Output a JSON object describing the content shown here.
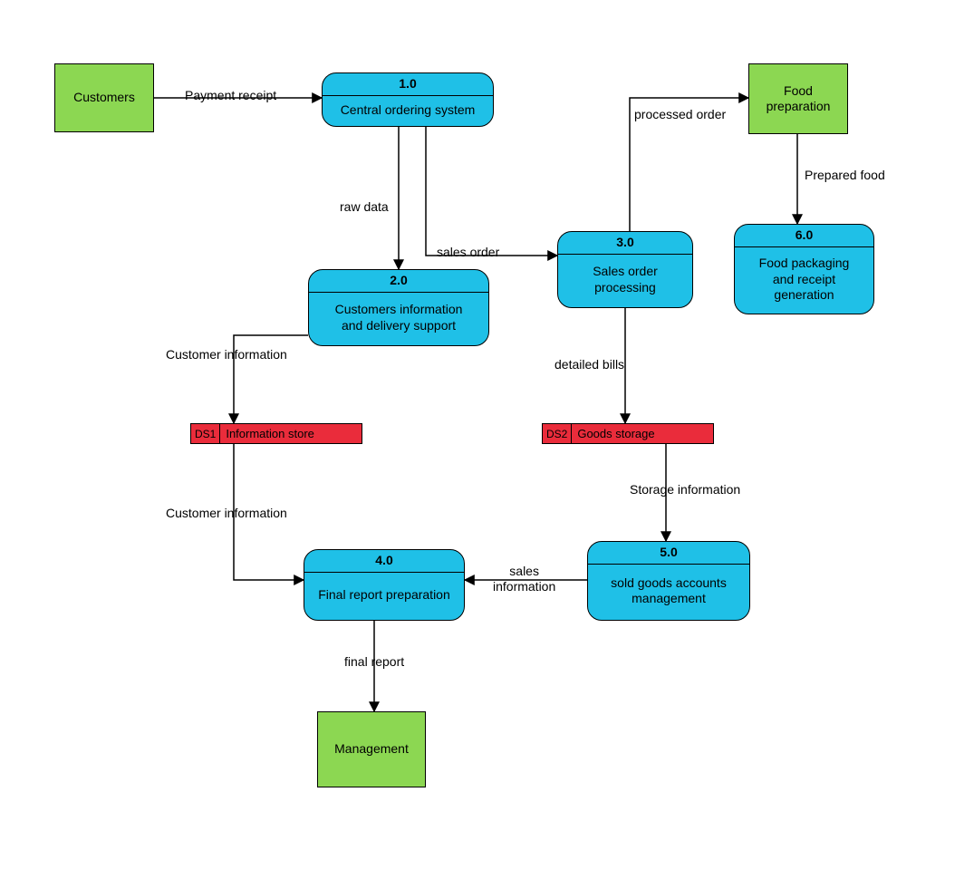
{
  "entities": {
    "customers": {
      "label": "Customers"
    },
    "food_prep": {
      "label": "Food\npreparation"
    },
    "management": {
      "label": "Management"
    }
  },
  "processes": {
    "p1": {
      "num": "1.0",
      "name": "Central ordering system"
    },
    "p2": {
      "num": "2.0",
      "name": "Customers information\nand delivery support"
    },
    "p3": {
      "num": "3.0",
      "name": "Sales order\nprocessing"
    },
    "p4": {
      "num": "4.0",
      "name": "Final report preparation"
    },
    "p5": {
      "num": "5.0",
      "name": "sold goods accounts\nmanagement"
    },
    "p6": {
      "num": "6.0",
      "name": "Food packaging\nand receipt\ngeneration"
    }
  },
  "datastores": {
    "ds1": {
      "id": "DS1",
      "name": "Information store"
    },
    "ds2": {
      "id": "DS2",
      "name": "Goods storage"
    }
  },
  "flows": {
    "f_payment_receipt": "Payment receipt",
    "f_raw_data": "raw data",
    "f_sales_order": "sales order",
    "f_customer_info_1": "Customer information",
    "f_customer_info_2": "Customer information",
    "f_processed_order": "processed order",
    "f_prepared_food": "Prepared food",
    "f_detailed_bills": "detailed bills",
    "f_storage_info": "Storage information",
    "f_sales_info": "sales\ninformation",
    "f_final_report": "final report"
  },
  "colors": {
    "entity": "#8cd752",
    "process": "#1fc0e7",
    "datastore": "#ea2c3b"
  }
}
